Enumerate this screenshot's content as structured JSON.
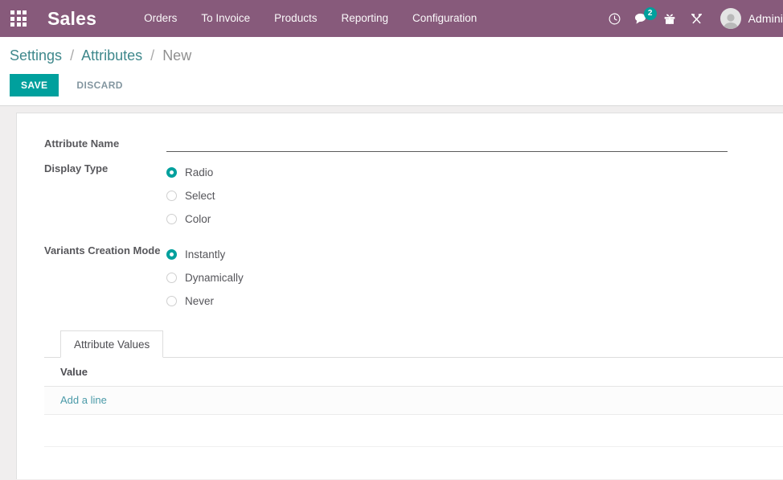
{
  "navbar": {
    "apps_icon": "apps-grid-icon",
    "brand": "Sales",
    "menu": [
      {
        "label": "Orders"
      },
      {
        "label": "To Invoice"
      },
      {
        "label": "Products"
      },
      {
        "label": "Reporting"
      },
      {
        "label": "Configuration"
      }
    ],
    "icons": [
      {
        "name": "clock-icon"
      },
      {
        "name": "chat-icon",
        "badge": "2"
      },
      {
        "name": "gift-icon"
      },
      {
        "name": "tools-icon"
      }
    ],
    "user": {
      "avatar": "user-avatar-icon",
      "name": "Admini"
    },
    "colors": {
      "background": "#875A7B",
      "badge": "#00a09d"
    }
  },
  "control_panel": {
    "breadcrumb": [
      {
        "label": "Settings",
        "type": "link"
      },
      {
        "label": "Attributes",
        "type": "link"
      },
      {
        "label": "New",
        "type": "current"
      }
    ],
    "separator": "/",
    "save_label": "SAVE",
    "discard_label": "DISCARD",
    "colors": {
      "save_button": "#00a09d",
      "link": "#3f888c"
    }
  },
  "form": {
    "attribute_name": {
      "label": "Attribute Name",
      "value": "",
      "placeholder": ""
    },
    "display_type": {
      "label": "Display Type",
      "selected": "Radio",
      "options": [
        {
          "label": "Radio",
          "selected": true
        },
        {
          "label": "Select",
          "selected": false
        },
        {
          "label": "Color",
          "selected": false
        }
      ]
    },
    "variants_creation_mode": {
      "label": "Variants Creation Mode",
      "selected": "Instantly",
      "options": [
        {
          "label": "Instantly",
          "selected": true
        },
        {
          "label": "Dynamically",
          "selected": false
        },
        {
          "label": "Never",
          "selected": false
        }
      ]
    },
    "notebook": {
      "tabs": [
        {
          "label": "Attribute Values",
          "active": true
        }
      ],
      "list": {
        "columns": [
          "Value"
        ],
        "rows": [],
        "add_line_label": "Add a line"
      }
    }
  }
}
